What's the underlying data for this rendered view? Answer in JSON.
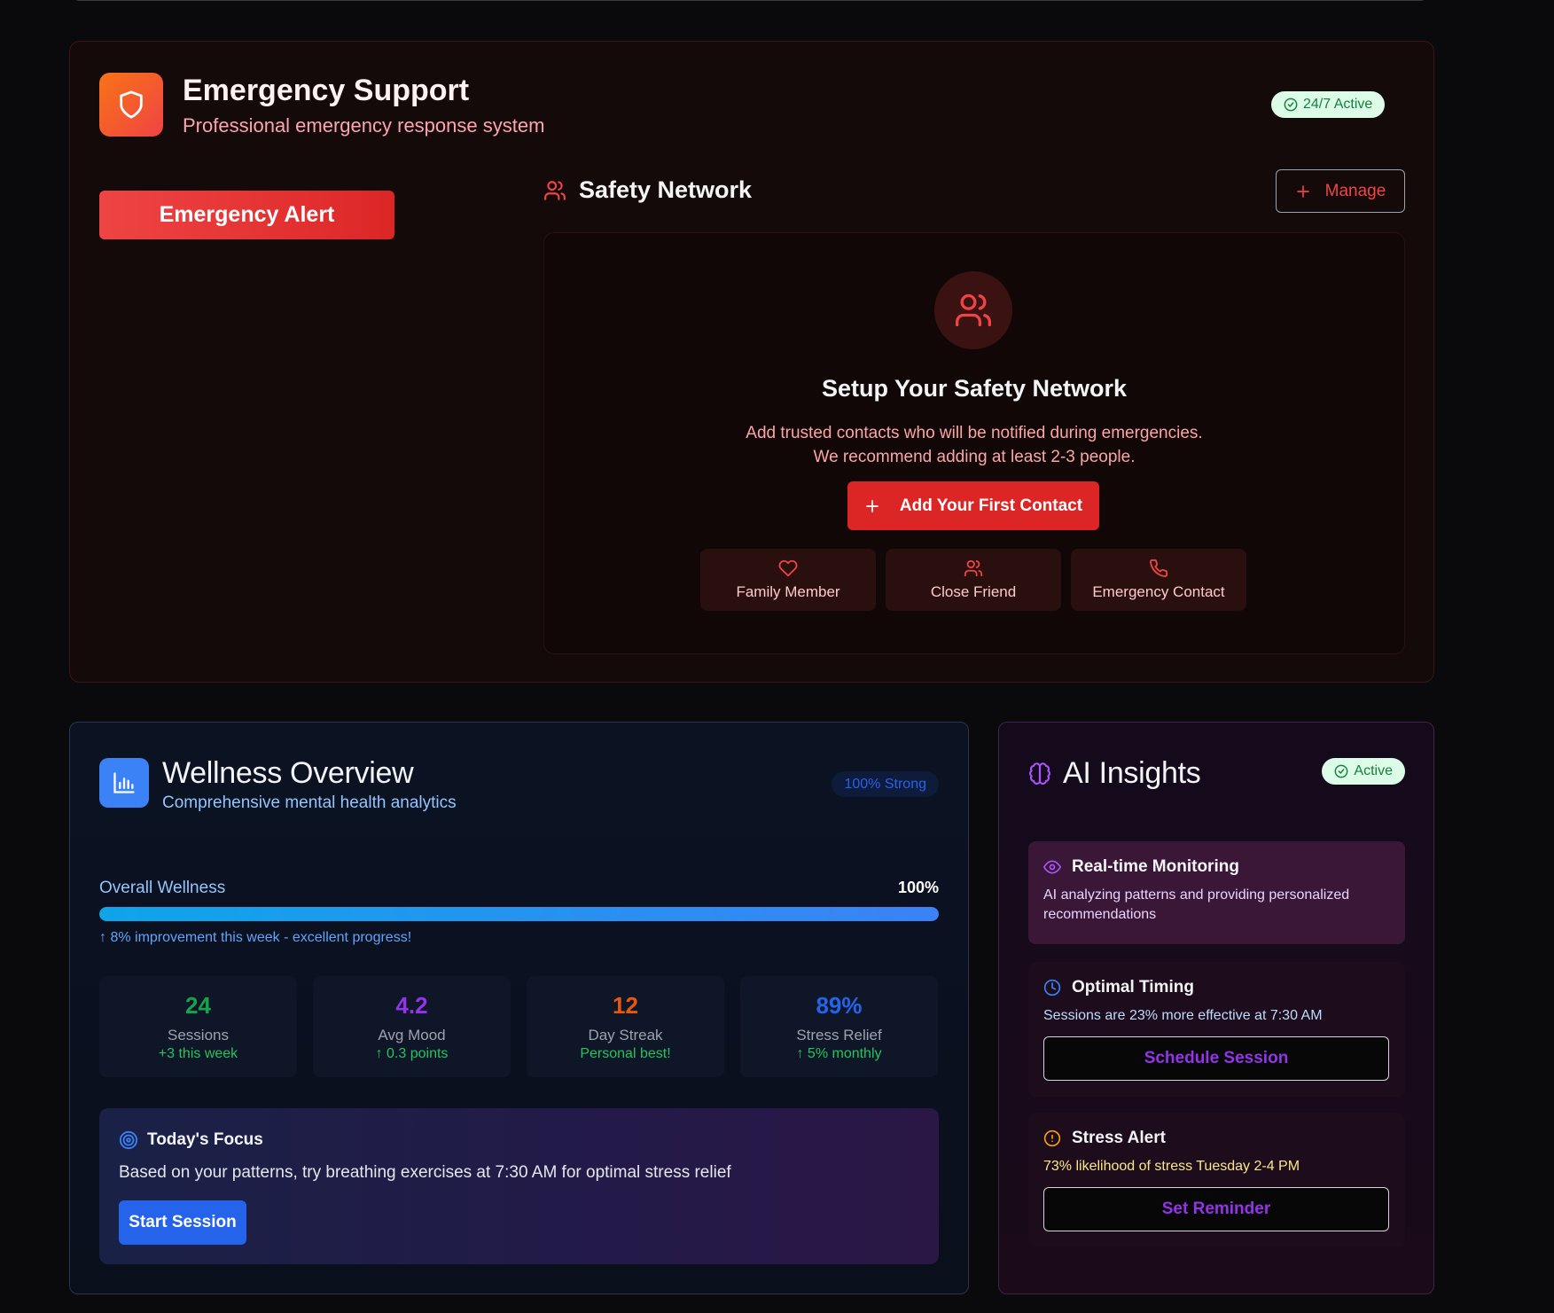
{
  "emergency": {
    "title": "Emergency Support",
    "subtitle": "Professional emergency response system",
    "status_badge": "24/7 Active",
    "alert_button": "Emergency Alert",
    "safety_network": {
      "title": "Safety Network",
      "manage_button": "Manage",
      "setup_title": "Setup Your Safety Network",
      "desc_line1": "Add trusted contacts who will be notified during emergencies.",
      "desc_line2": "We recommend adding at least 2-3 people.",
      "add_button": "Add Your First Contact",
      "contact_types": [
        {
          "label": "Family Member",
          "icon": "heart-icon"
        },
        {
          "label": "Close Friend",
          "icon": "users-icon"
        },
        {
          "label": "Emergency Contact",
          "icon": "phone-icon"
        }
      ]
    }
  },
  "wellness": {
    "title": "Wellness Overview",
    "subtitle": "Comprehensive mental health analytics",
    "badge": "100% Strong",
    "overall_label": "Overall Wellness",
    "overall_value": "100%",
    "overall_fraction": 1.0,
    "improvement_note": "↑ 8% improvement this week - excellent progress!",
    "stats": [
      {
        "value": "24",
        "label": "Sessions",
        "change": "+3 this week",
        "color": "#16a34a"
      },
      {
        "value": "4.2",
        "label": "Avg Mood",
        "change": "↑ 0.3 points",
        "color": "#9333ea"
      },
      {
        "value": "12",
        "label": "Day Streak",
        "change": "Personal best!",
        "color": "#ea580c"
      },
      {
        "value": "89%",
        "label": "Stress Relief",
        "change": "↑ 5% monthly",
        "color": "#2563eb"
      }
    ],
    "focus": {
      "title": "Today's Focus",
      "text": "Based on your patterns, try breathing exercises at 7:30 AM for optimal stress relief",
      "button": "Start Session"
    }
  },
  "ai_insights": {
    "title": "AI Insights",
    "status_badge": "Active",
    "cards": [
      {
        "title": "Real-time Monitoring",
        "text": "AI analyzing patterns and providing personalized recommendations",
        "icon": "eye-icon"
      },
      {
        "title": "Optimal Timing",
        "text": "Sessions are 23% more effective at 7:30 AM",
        "button": "Schedule Session",
        "icon": "clock-icon"
      },
      {
        "title": "Stress Alert",
        "text": "73% likelihood of stress Tuesday 2-4 PM",
        "button": "Set Reminder",
        "icon": "alert-circle-icon"
      }
    ]
  },
  "colors": {
    "emergency_red": "#dc2626",
    "accent_blue": "#2563eb",
    "accent_purple": "#9333ea",
    "active_green": "#15803d"
  }
}
